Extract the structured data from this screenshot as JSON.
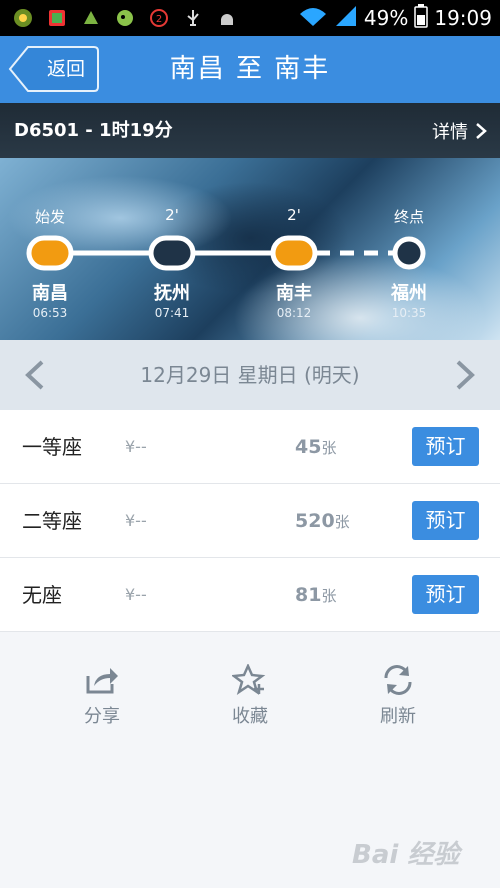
{
  "status_bar": {
    "battery": "49%",
    "time": "19:09"
  },
  "header": {
    "back_label": "返回",
    "title": "南昌 至 南丰"
  },
  "train": {
    "summary": "D6501 - 1时19分",
    "details_label": "详情"
  },
  "route": {
    "stops": [
      {
        "top": "始发",
        "name": "南昌",
        "time": "06:53"
      },
      {
        "top": "2'",
        "name": "抚州",
        "time": "07:41"
      },
      {
        "top": "2'",
        "name": "南丰",
        "time": "08:12"
      },
      {
        "top": "终点",
        "name": "福州",
        "time": "10:35"
      }
    ]
  },
  "date": {
    "text": "12月29日 星期日 (明天)"
  },
  "seats": [
    {
      "name": "一等座",
      "price": "¥--",
      "count": "45",
      "unit": "张",
      "button": "预订"
    },
    {
      "name": "二等座",
      "price": "¥--",
      "count": "520",
      "unit": "张",
      "button": "预订"
    },
    {
      "name": "无座",
      "price": "¥--",
      "count": "81",
      "unit": "张",
      "button": "预订"
    }
  ],
  "actions": {
    "share": "分享",
    "favorite": "收藏",
    "refresh": "刷新"
  },
  "watermark": "Bai 经验",
  "colors": {
    "primary": "#3b8de0",
    "highlight": "#f29b11"
  }
}
